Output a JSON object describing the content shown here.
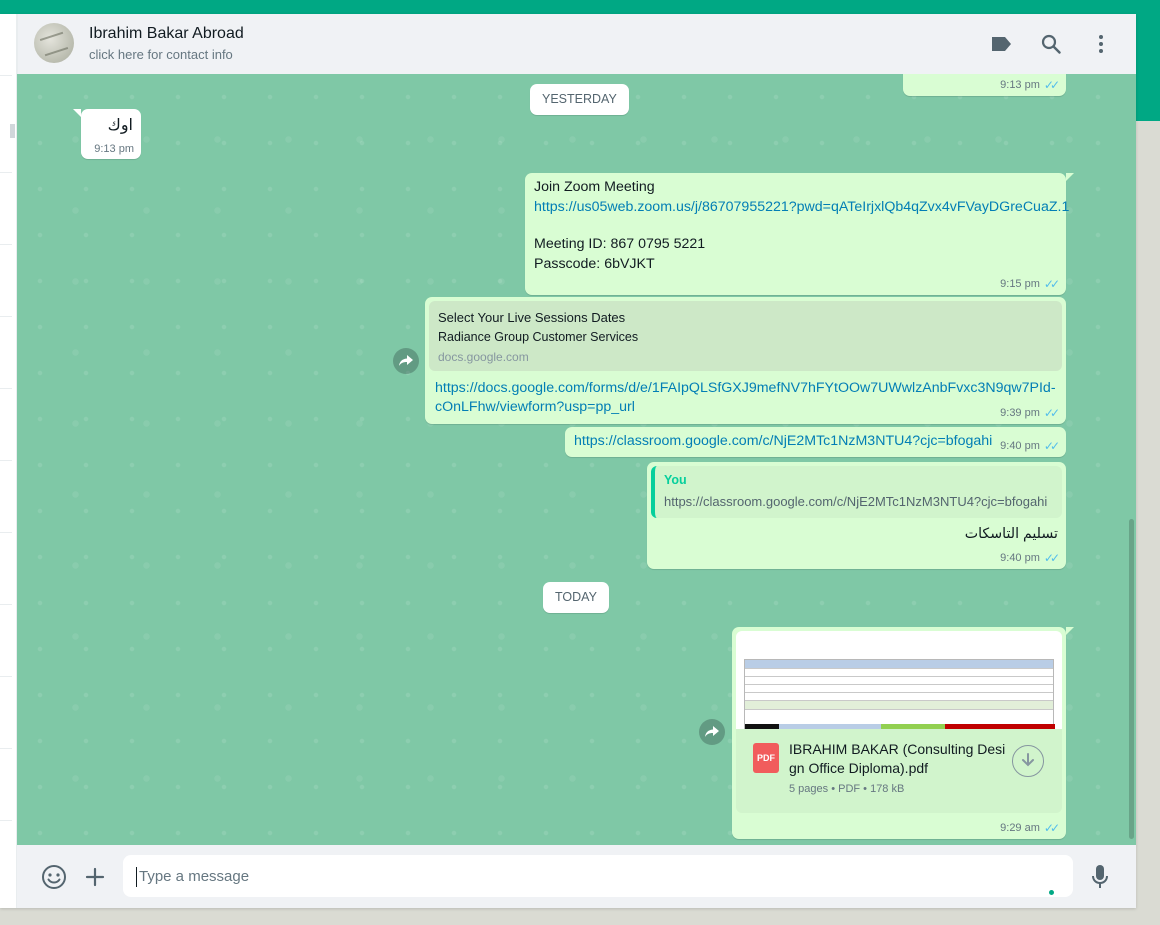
{
  "header": {
    "contact_name": "Ibrahim Bakar Abroad",
    "contact_subtitle": "click here for contact info",
    "icons": [
      "label-icon",
      "search-icon",
      "menu-icon"
    ]
  },
  "chat": {
    "date_yesterday": "YESTERDAY",
    "date_today": "TODAY",
    "msg_top_time": "9:13 pm",
    "msg_in_text": "اوك",
    "msg_in_time": "9:13 pm",
    "zoom": {
      "line1": "Join Zoom Meeting",
      "link": "https://us05web.zoom.us/j/86707955221?pwd=qATeIrjxlQb4qZvx4vFVayDGreCuaZ.1",
      "meeting_id": "Meeting ID: 867 0795 5221",
      "passcode": "Passcode: 6bVJKT",
      "time": "9:15 pm"
    },
    "forms": {
      "preview_title": "Select Your Live Sessions Dates",
      "preview_desc": "Radiance Group Customer Services",
      "preview_domain": "docs.google.com",
      "link_line1": "https://docs.google.com/forms/d/e/1FAIpQLSfGXJ9mefNV7hFYtOOw7UWwlzAnbFvxc3N9qw7PId-",
      "link_line2": "cOnLFhw/viewform?usp=pp_url",
      "time": "9:39 pm"
    },
    "classroom": {
      "link": "https://classroom.google.com/c/NjE2MTc1NzM3NTU4?cjc=bfogahi",
      "time": "9:40 pm"
    },
    "reply": {
      "quoted_author": "You",
      "quoted_text": "https://classroom.google.com/c/NjE2MTc1NzM3NTU4?cjc=bfogahi",
      "text": "تسليم التاسكات",
      "time": "9:40 pm"
    },
    "document": {
      "pdf_label": "PDF",
      "name_line1": "IBRAHIM BAKAR (Consulting Desi",
      "name_line2": "gn Office Diploma).pdf",
      "meta": "5 pages • PDF • 178 kB",
      "time": "9:29 am"
    }
  },
  "composer": {
    "placeholder": "Type a message"
  },
  "colors": {
    "accent": "#00a884",
    "chat_bg": "#7fc8a6",
    "outgoing_bubble": "#d9fdd3",
    "link": "#027eb5",
    "read_ticks": "#53bdeb"
  }
}
